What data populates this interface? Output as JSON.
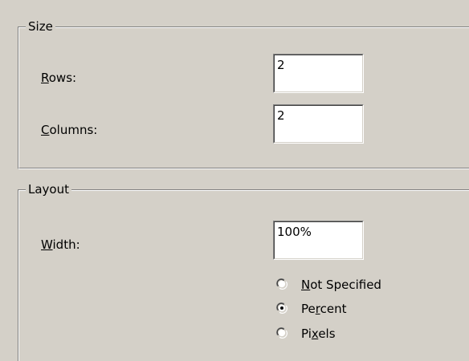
{
  "size_group": {
    "legend": "Size",
    "rows": {
      "label_accel": "R",
      "label_rest": "ows:",
      "value": "2"
    },
    "columns": {
      "label_accel": "C",
      "label_rest": "olumns:",
      "value": "2"
    }
  },
  "layout_group": {
    "legend": "Layout",
    "width": {
      "label_accel": "W",
      "label_rest": "idth:",
      "value": "100%"
    },
    "width_units": [
      {
        "before": "",
        "accel": "N",
        "after": "ot Specified",
        "selected": false
      },
      {
        "before": "Pe",
        "accel": "r",
        "after": "cent",
        "selected": true
      },
      {
        "before": "Pi",
        "accel": "x",
        "after": "els",
        "selected": false
      }
    ]
  },
  "colors": {
    "dialog_face": "#d4d0c8",
    "highlight": "#ffffff",
    "shadow": "#808080",
    "dark_shadow": "#404040",
    "text": "#000000"
  }
}
